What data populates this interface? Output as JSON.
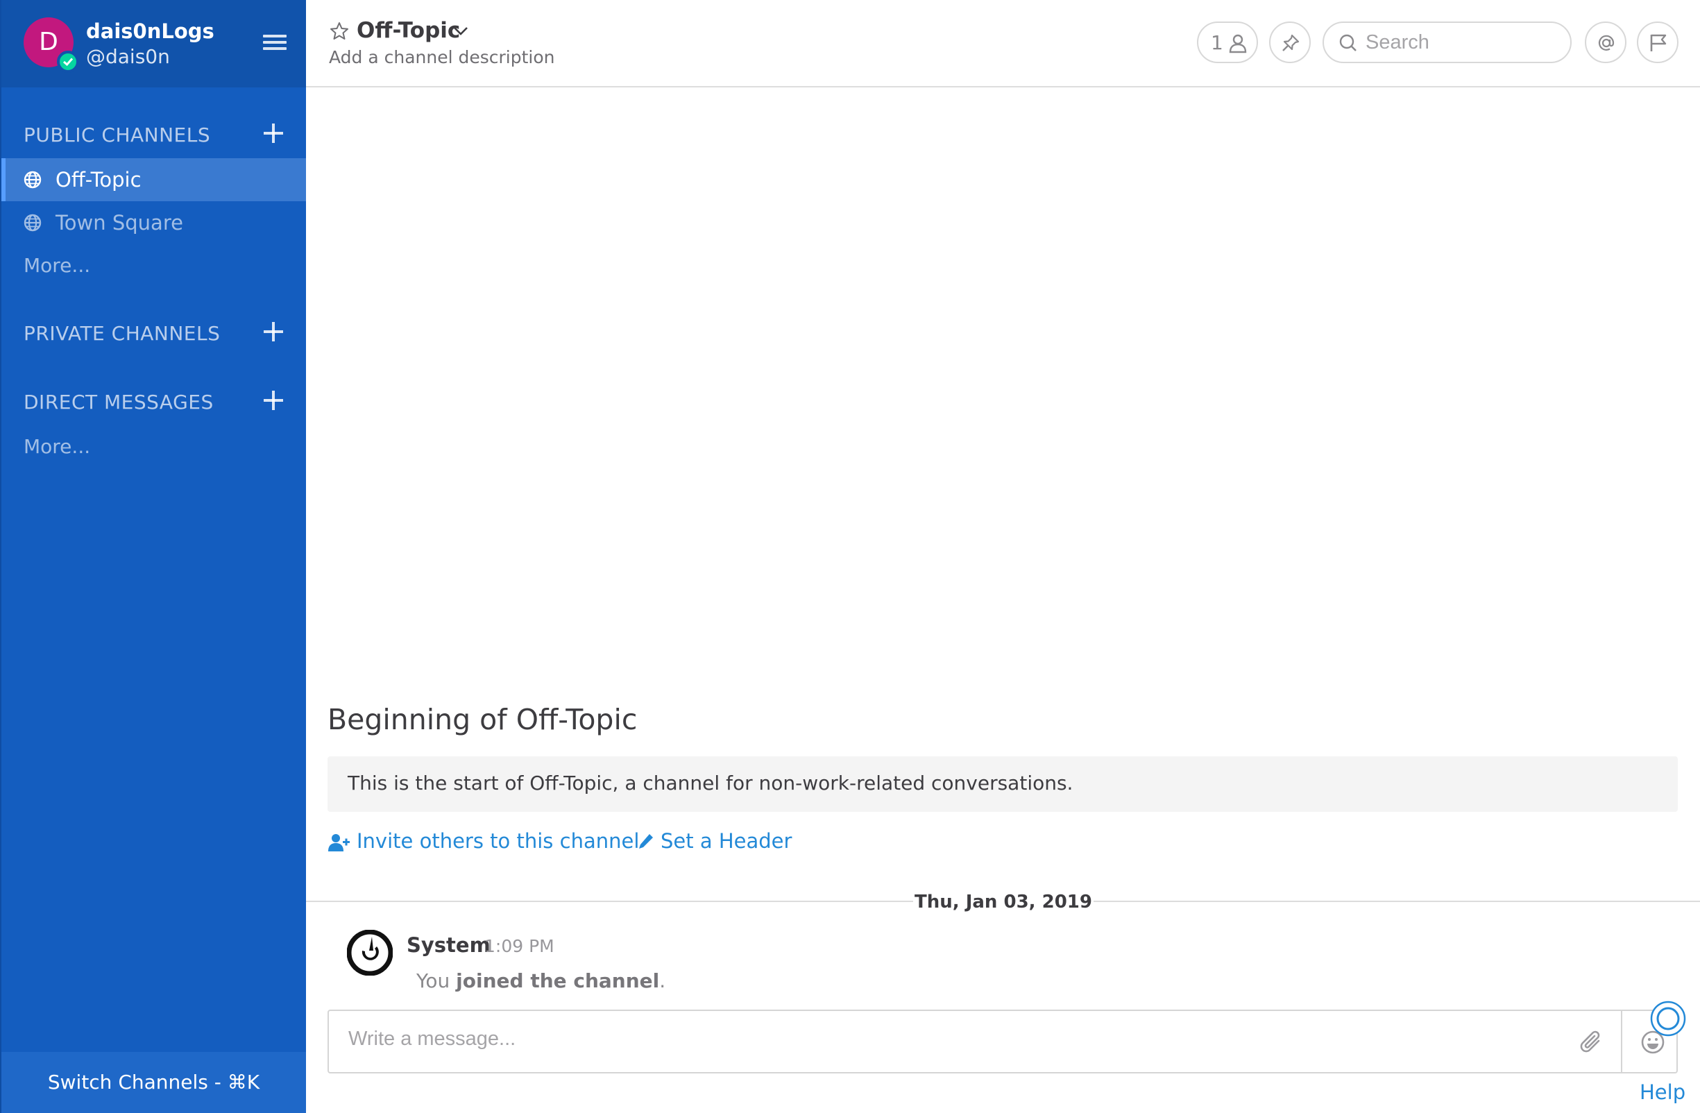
{
  "user": {
    "initial": "D",
    "display_name": "dais0nLogs",
    "handle": "@dais0n"
  },
  "sidebar": {
    "public_channels_title": "PUBLIC CHANNELS",
    "public_channels": [
      {
        "label": "Off-Topic",
        "active": true
      },
      {
        "label": "Town Square",
        "active": false
      }
    ],
    "public_more": "More...",
    "private_channels_title": "PRIVATE CHANNELS",
    "direct_messages_title": "DIRECT MESSAGES",
    "dm_more": "More...",
    "switch_channels": "Switch Channels - ⌘K"
  },
  "header": {
    "channel_name": "Off-Topic",
    "description": "Add a channel description",
    "member_count": "1",
    "search_placeholder": "Search"
  },
  "intro": {
    "title": "Beginning of Off-Topic",
    "text": "This is the start of Off-Topic, a channel for non-work-related conversations.",
    "invite_link": "Invite others to this channel",
    "header_link": "Set a Header"
  },
  "date_separator": "Thu, Jan 03, 2019",
  "post": {
    "username": "System",
    "time": "1:09 PM",
    "message_prefix": "You",
    "message_bold": "joined the channel",
    "message_suffix": "."
  },
  "composer": {
    "placeholder": "Write a message..."
  },
  "help": "Help",
  "icons": {
    "member": "member-icon",
    "pin": "pin-icon",
    "search": "search-icon",
    "mention": "at-mention-icon",
    "flag": "flag-icon",
    "star": "star-icon",
    "globe": "globe-icon",
    "attach": "paperclip-icon",
    "emoji": "emoji-icon"
  },
  "colors": {
    "sidebar_bg": "#145dbf",
    "sidebar_header_bg": "#1153ab",
    "active_channel_bg": "#3a7ad0",
    "link": "#2389d7",
    "avatar_bg": "#c2187e",
    "online_status": "#06d6a0"
  }
}
